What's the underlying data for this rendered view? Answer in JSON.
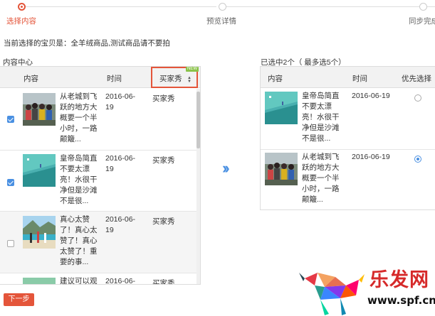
{
  "steps": [
    {
      "label": "选择内容",
      "active": true
    },
    {
      "label": "预览详情",
      "active": false
    },
    {
      "label": "同步完成",
      "active": false
    }
  ],
  "notice": "当前选择的宝贝是：全羊绒商品,测试商品请不要拍",
  "left_panel": {
    "title": "内容中心",
    "columns": {
      "content": "内容",
      "time": "时间",
      "source": "买家秀"
    },
    "new_badge": "NEW",
    "rows": [
      {
        "checked": true,
        "text": "从老城到飞跃的地方大概要一个半小时，一路颠簸...",
        "date": "2016-06-19",
        "source": "买家秀"
      },
      {
        "checked": true,
        "text": "皇帝岛简直不要太漂亮！水很干净但是沙滩不是很...",
        "date": "2016-06-19",
        "source": "买家秀"
      },
      {
        "checked": false,
        "text": "真心太赞了！真心太赞了！真心太赞了！重要的事...",
        "date": "2016-06-19",
        "source": "买家秀"
      },
      {
        "checked": false,
        "text": "建议可以观",
        "date": "2016-06-",
        "source": "买家秀"
      }
    ]
  },
  "right_panel": {
    "title": "已选中2个（ 最多选5个）",
    "columns": {
      "content": "内容",
      "time": "时间",
      "preferred": "优先选择"
    },
    "rows": [
      {
        "text": "皇帝岛简直不要太漂亮！水很干净但是沙滩不是很...",
        "date": "2016-06-19",
        "preferred": false
      },
      {
        "text": "从老城到飞跃的地方大概要一个半小时，一路颠簸...",
        "date": "2016-06-19",
        "preferred": true
      }
    ]
  },
  "next_button": "下一步",
  "watermark": {
    "text": "乐发网",
    "url": "www.spf.cn"
  },
  "colors": {
    "accent": "#e4553a",
    "blue": "#4a90e2"
  }
}
